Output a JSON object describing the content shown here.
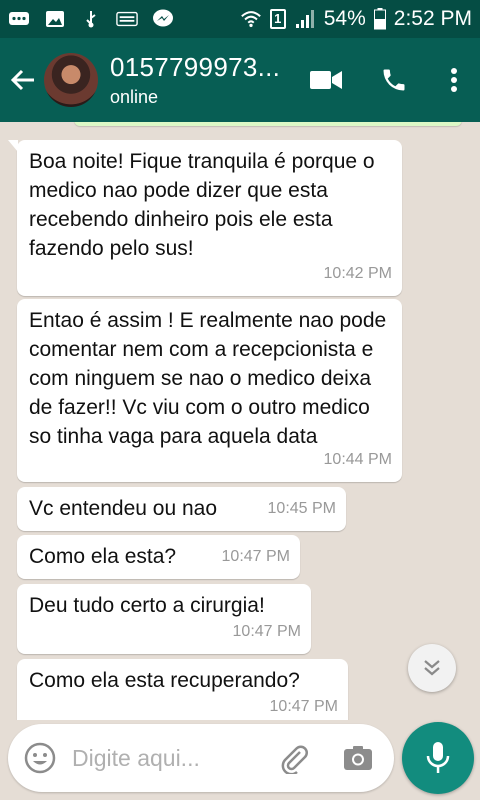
{
  "status_bar": {
    "icons": [
      "chat-notification-icon",
      "image-notification-icon",
      "usb-icon",
      "palco-mp3-icon",
      "messenger-icon",
      "wifi-icon",
      "sim-icon",
      "signal-icon",
      "battery-icon"
    ],
    "sim_label": "1",
    "battery": "54%",
    "time": "2:52 PM"
  },
  "header": {
    "contact_name": "0157799973...",
    "contact_status": "online",
    "colors": {
      "primary": "#075e54",
      "status_bar": "#054d44",
      "accent": "#128c7e"
    }
  },
  "messages": [
    {
      "text": "Boa noite! Fique tranquila é porque o medico nao pode dizer que esta recebendo dinheiro pois ele esta fazendo pelo sus!",
      "time": "10:42 PM"
    },
    {
      "text": "Entao é assim ! E realmente nao pode comentar nem com a recepcionista e com ninguem se nao o medico deixa de fazer!! Vc viu com o outro medico so tinha vaga para aquela data",
      "time": "10:44 PM"
    },
    {
      "text": "Vc entendeu ou nao",
      "time": "10:45 PM"
    },
    {
      "text": "Como ela esta?",
      "time": "10:47 PM"
    },
    {
      "text": "Deu tudo certo a cirurgia!",
      "time": "10:47 PM"
    },
    {
      "text": "Como ela esta recuperando?",
      "time": "10:47 PM"
    }
  ],
  "composer": {
    "placeholder": "Digite aqui..."
  }
}
